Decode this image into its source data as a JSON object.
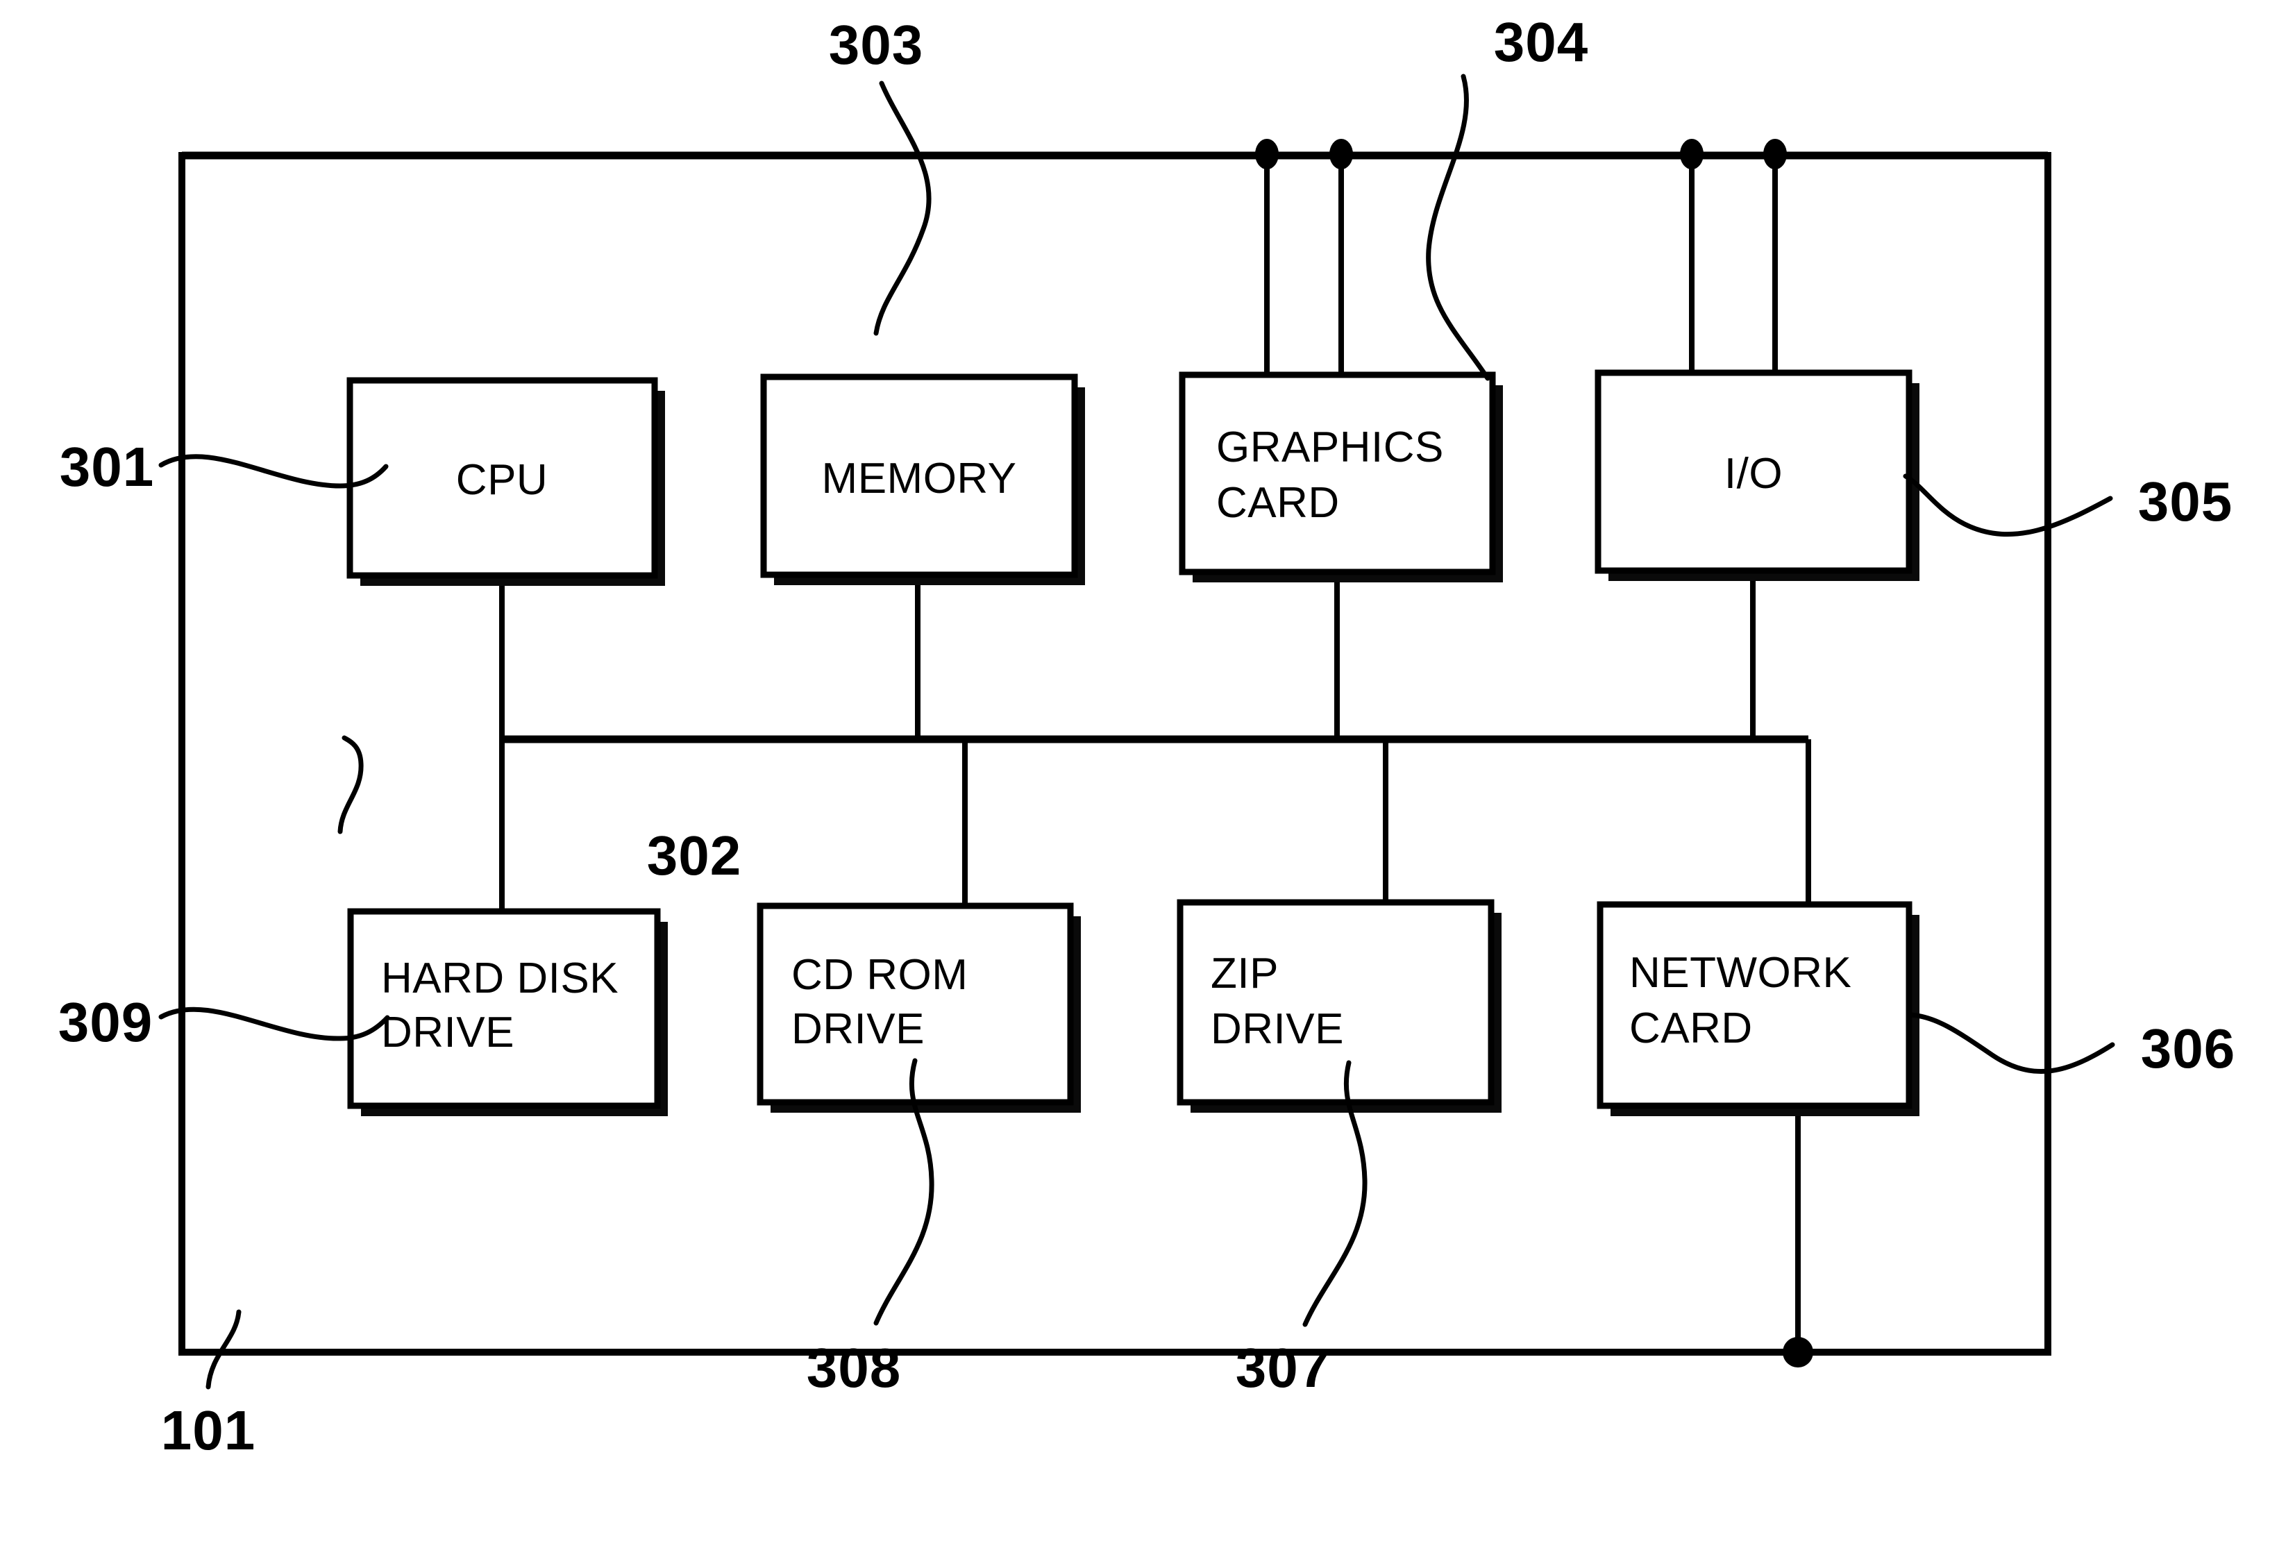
{
  "figure": {
    "title": "Computer system block diagram",
    "background_color": "#ffffff",
    "line_color": "#000000"
  },
  "blocks": [
    {
      "id": "cpu",
      "label_line1": "CPU",
      "label_line2": "",
      "ref": "301"
    },
    {
      "id": "memory",
      "label_line1": "MEMORY",
      "label_line2": "",
      "ref": "303"
    },
    {
      "id": "graphics",
      "label_line1": "GRAPHICS",
      "label_line2": "CARD",
      "ref": "304"
    },
    {
      "id": "io",
      "label_line1": "I/O",
      "label_line2": "",
      "ref": "305"
    },
    {
      "id": "harddisk",
      "label_line1": "HARD DISK",
      "label_line2": "DRIVE",
      "ref": "309"
    },
    {
      "id": "cdrom",
      "label_line1": "CD ROM",
      "label_line2": "DRIVE",
      "ref": "308"
    },
    {
      "id": "zip",
      "label_line1": "ZIP",
      "label_line2": "DRIVE",
      "ref": "307"
    },
    {
      "id": "network",
      "label_line1": "NETWORK",
      "label_line2": "CARD",
      "ref": "306"
    }
  ],
  "reference_numerals": [
    {
      "id": "ref-301",
      "text": "301",
      "points_to": "cpu"
    },
    {
      "id": "ref-302",
      "text": "302",
      "points_to": "system-bus"
    },
    {
      "id": "ref-303",
      "text": "303",
      "points_to": "memory"
    },
    {
      "id": "ref-304",
      "text": "304",
      "points_to": "graphics"
    },
    {
      "id": "ref-305",
      "text": "305",
      "points_to": "io"
    },
    {
      "id": "ref-306",
      "text": "306",
      "points_to": "network"
    },
    {
      "id": "ref-307",
      "text": "307",
      "points_to": "zip"
    },
    {
      "id": "ref-308",
      "text": "308",
      "points_to": "cdrom"
    },
    {
      "id": "ref-309",
      "text": "309",
      "points_to": "harddisk"
    },
    {
      "id": "ref-101",
      "text": "101",
      "points_to": "outer-enclosure"
    }
  ],
  "labels": {
    "cpu": "CPU",
    "memory": "MEMORY",
    "graphics_l1": "GRAPHICS",
    "graphics_l2": "CARD",
    "io": "I/O",
    "harddisk_l1": "HARD DISK",
    "harddisk_l2": "DRIVE",
    "cdrom_l1": "CD ROM",
    "cdrom_l2": "DRIVE",
    "zip_l1": "ZIP",
    "zip_l2": "DRIVE",
    "network_l1": "NETWORK",
    "network_l2": "CARD"
  },
  "refs": {
    "n301": "301",
    "n302": "302",
    "n303": "303",
    "n304": "304",
    "n305": "305",
    "n306": "306",
    "n307": "307",
    "n308": "308",
    "n309": "309",
    "n101": "101"
  }
}
